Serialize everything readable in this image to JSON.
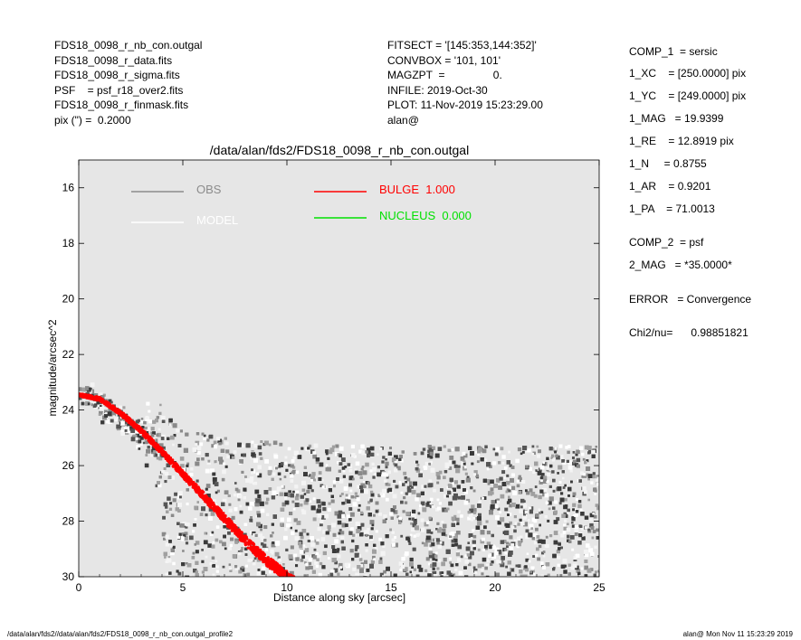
{
  "header_left": [
    "FDS18_0098_r_nb_con.outgal",
    "FDS18_0098_r_data.fits",
    "FDS18_0098_r_sigma.fits",
    "PSF    = psf_r18_over2.fits",
    "FDS18_0098_r_finmask.fits",
    "pix (\") =  0.2000"
  ],
  "header_mid": [
    "FITSECT = '[145:353,144:352]'",
    "CONVBOX = '101, 101'",
    "MAGZPT  =                0.",
    "INFILE: 2019-Oct-30",
    "PLOT: 11-Nov-2019 15:23:29.00",
    "alan@"
  ],
  "header_right": [
    "COMP_1  = sersic",
    "1_XC    = [250.0000] pix",
    "1_YC    = [249.0000] pix",
    "1_MAG   = 19.9399",
    "1_RE    = 12.8919 pix",
    "1_N     = 0.8755",
    "1_AR    = 0.9201",
    "1_PA    = 71.0013",
    "COMP_2  = psf",
    "2_MAG   = *35.0000*",
    "ERROR   = Convergence",
    "Chi2/nu=      0.98851821"
  ],
  "footer_left": "/data/alan/fds2//data/alan/fds2/FDS18_0098_r_nb_con.outgal_profile2",
  "footer_right": "alan@  Mon Nov 11 15:23:29 2019",
  "chart_data": {
    "type": "scatter",
    "title": "/data/alan/fds2/FDS18_0098_r_nb_con.outgal",
    "xlabel": "Distance along sky [arcsec]",
    "ylabel": "magnitude/arcsec^2",
    "xlim": [
      0,
      25
    ],
    "ylim": [
      30,
      15
    ],
    "y_inverted": true,
    "x_ticks": [
      "0",
      "5",
      "10",
      "15",
      "20",
      "25"
    ],
    "y_ticks": [
      "16",
      "18",
      "20",
      "22",
      "24",
      "26",
      "28",
      "30"
    ],
    "background": "#e6e6e6",
    "legend": [
      {
        "label": "OBS",
        "color": "#8c8c8c"
      },
      {
        "label": "MODEL",
        "color": "#ffffff"
      },
      {
        "label": "BULGE  1.000",
        "color": "#ff0000"
      },
      {
        "label": "NUCLEUS  0.000",
        "color": "#00e000"
      }
    ],
    "series": [
      {
        "name": "OBS",
        "color": "#404040",
        "x": [
          0.2,
          0.5,
          1.0,
          1.5,
          2.0,
          2.5,
          3.0,
          3.5,
          4.0,
          4.5,
          5.0,
          6.0,
          7.0,
          8.0,
          10.0,
          12.0,
          15.0,
          18.0,
          20.0,
          22.0,
          25.0
        ],
        "y": [
          23.6,
          23.6,
          23.8,
          24.0,
          24.3,
          24.6,
          24.9,
          25.2,
          25.4,
          25.6,
          25.8,
          26.0,
          26.2,
          26.3,
          26.4,
          26.5,
          26.5,
          26.5,
          26.5,
          26.5,
          26.5
        ]
      },
      {
        "name": "MODEL",
        "color": "#ffffff",
        "x": [
          0.0,
          1.0,
          2.0,
          3.0,
          4.0,
          5.0,
          6.0,
          7.0,
          8.0,
          9.0,
          10.0,
          10.5
        ],
        "y": [
          23.45,
          23.6,
          24.1,
          24.75,
          25.5,
          26.3,
          27.1,
          27.9,
          28.7,
          29.4,
          30.0,
          30.3
        ]
      },
      {
        "name": "BULGE  1.000",
        "color": "#ff0000",
        "x": [
          0.0,
          1.0,
          2.0,
          3.0,
          4.0,
          5.0,
          6.0,
          7.0,
          8.0,
          9.0,
          10.0,
          10.5
        ],
        "y": [
          23.45,
          23.6,
          24.1,
          24.75,
          25.5,
          26.3,
          27.1,
          27.9,
          28.7,
          29.4,
          30.0,
          30.3
        ]
      }
    ]
  }
}
